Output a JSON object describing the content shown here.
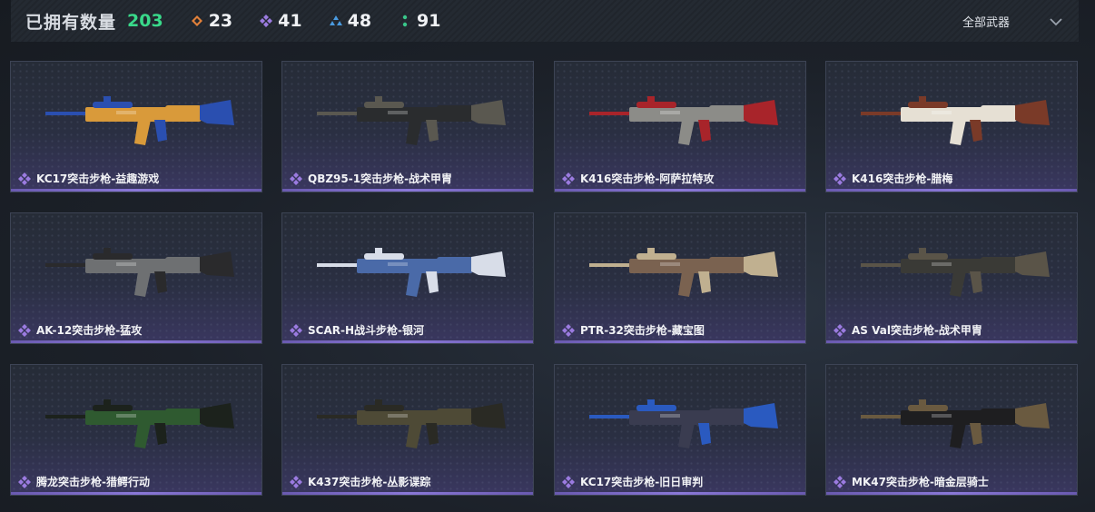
{
  "header": {
    "owned_label": "已拥有数量",
    "owned_count": "203",
    "stats": [
      {
        "icon": "orange-diamond-icon",
        "color": "#e0803a",
        "value": "23"
      },
      {
        "icon": "purple-diamond-icon",
        "color": "#9b7be0",
        "value": "41"
      },
      {
        "icon": "blue-triangle-icon",
        "color": "#4a9be0",
        "value": "48"
      },
      {
        "icon": "green-dots-icon",
        "color": "#39c78a",
        "value": "91"
      }
    ],
    "filter_label": "全部武器"
  },
  "weapons": [
    {
      "name": "KC17突击步枪-益趣游戏",
      "rarity": "purple",
      "skin": "#d99a3a",
      "accent": "#2a4fb0"
    },
    {
      "name": "QBZ95-1突击步枪-战术甲胄",
      "rarity": "purple",
      "skin": "#2a2c2e",
      "accent": "#5a5850"
    },
    {
      "name": "K416突击步枪-阿萨拉特攻",
      "rarity": "purple",
      "skin": "#8c8c88",
      "accent": "#a8242a"
    },
    {
      "name": "K416突击步枪-腊梅",
      "rarity": "purple",
      "skin": "#e6e0d4",
      "accent": "#7a3a28"
    },
    {
      "name": "AK-12突击步枪-猛攻",
      "rarity": "purple",
      "skin": "#6e7072",
      "accent": "#2a2a2c"
    },
    {
      "name": "SCAR-H战斗步枪-银河",
      "rarity": "purple",
      "skin": "#4a6aa8",
      "accent": "#d8dde8"
    },
    {
      "name": "PTR-32突击步枪-藏宝图",
      "rarity": "purple",
      "skin": "#7a6250",
      "accent": "#c0b090"
    },
    {
      "name": "AS Val突击步枪-战术甲胄",
      "rarity": "purple",
      "skin": "#3a3a36",
      "accent": "#5a5448"
    },
    {
      "name": "腾龙突击步枪-猎鳄行动",
      "rarity": "purple",
      "skin": "#2f5a30",
      "accent": "#1c221c"
    },
    {
      "name": "K437突击步枪-丛影谍踪",
      "rarity": "purple",
      "skin": "#4e4a36",
      "accent": "#2a2a24"
    },
    {
      "name": "KC17突击步枪-旧日审判",
      "rarity": "purple",
      "skin": "#3a3c50",
      "accent": "#2a5ac0"
    },
    {
      "name": "MK47突击步枪-暗金层骑士",
      "rarity": "purple",
      "skin": "#1e1e20",
      "accent": "#6a5a40"
    }
  ]
}
